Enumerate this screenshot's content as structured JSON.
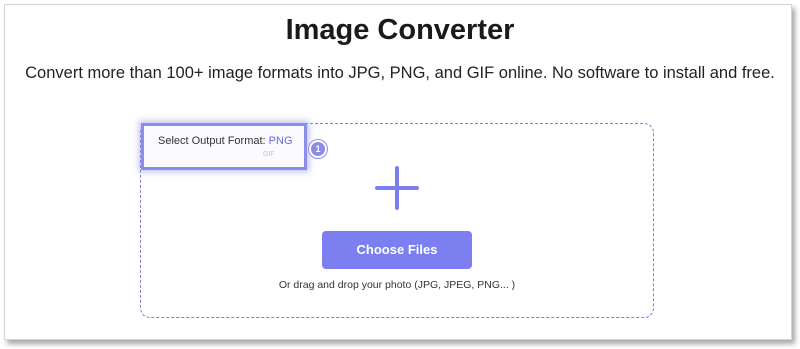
{
  "header": {
    "title": "Image Converter",
    "subtitle": "Convert more than 100+ image formats into JPG, PNG, and GIF online. No software to install and free."
  },
  "format_selector": {
    "label": "Select Output Format:",
    "selected": "PNG",
    "next_option": "GIF",
    "step_number": "1"
  },
  "dropzone": {
    "add_icon": "plus-icon",
    "button_label": "Choose Files",
    "hint": "Or drag and drop your photo (JPG, JPEG, PNG... )"
  },
  "colors": {
    "accent": "#7b7ff0",
    "highlight": "#8a8ee6",
    "dashed_border": "#7b7fd6"
  }
}
